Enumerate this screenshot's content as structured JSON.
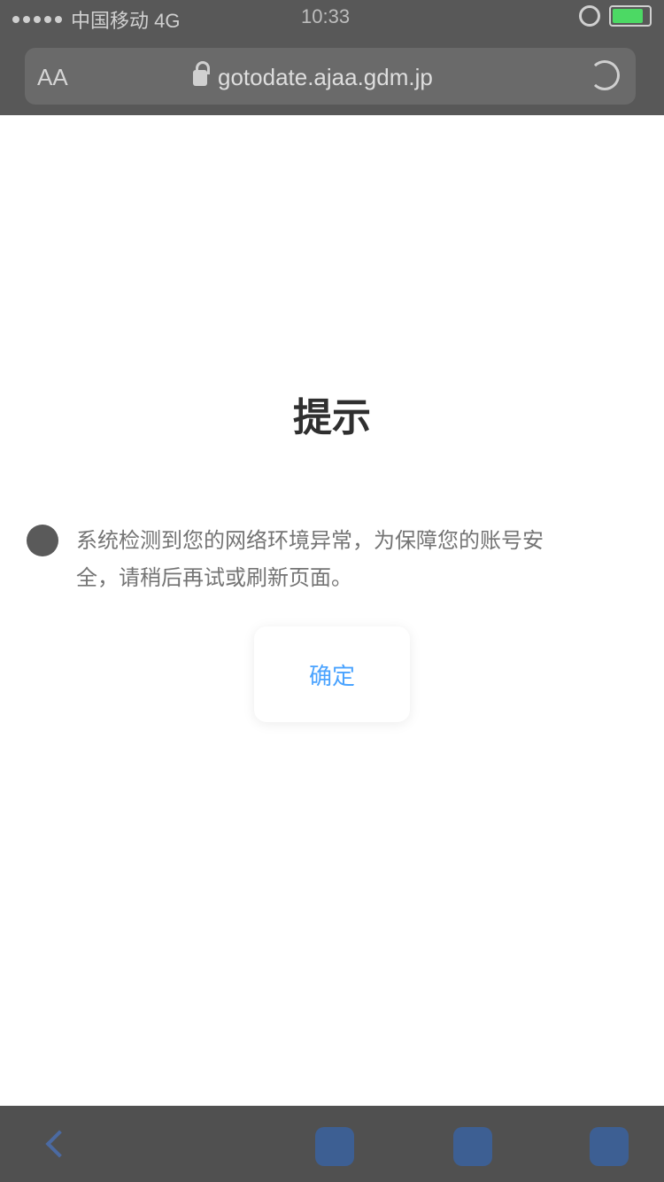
{
  "status_bar": {
    "carrier": "中国移动 4G",
    "time": "10:33",
    "battery_label": ""
  },
  "browser": {
    "aa_label": "AA",
    "url": "gotodate.ajaa.gdm.jp",
    "reload_icon": "reload-icon"
  },
  "page": {
    "title": "提示",
    "notice": "系统检测到您的网络环境异常，为保障您的账号安全，请稍后再试或刷新页面。",
    "button_label": "确定"
  },
  "toolbar": {
    "icons": [
      "back-chevron-icon",
      "share-icon",
      "bookmark-icon",
      "tabs-icon"
    ]
  },
  "colors": {
    "chrome": "#585858",
    "button_text": "#4aa3ff",
    "toolbar_icon": "#3d5f93",
    "battery": "#4cd964"
  }
}
